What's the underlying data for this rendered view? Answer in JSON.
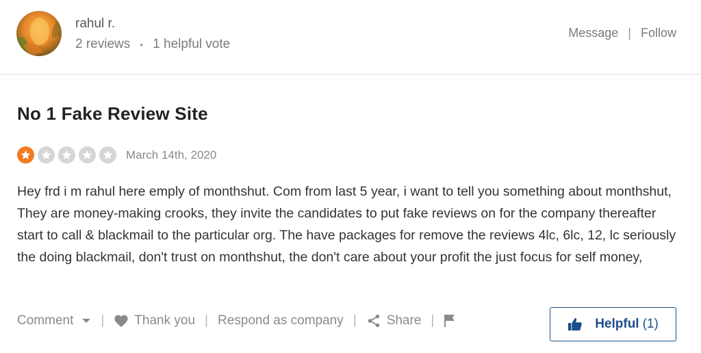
{
  "user": {
    "name": "rahul r.",
    "reviews": "2 reviews",
    "separator": "•",
    "helpful_votes": "1 helpful vote"
  },
  "header_actions": {
    "message": "Message",
    "separator": "|",
    "follow": "Follow"
  },
  "review": {
    "title": "No 1 Fake Review Site",
    "rating": 1,
    "rating_max": 5,
    "date": "March 14th, 2020",
    "text": "Hey frd i m rahul here emply of monthshut. Com from last 5 year, i want to tell you something about monthshut, They are money-making crooks, they invite the candidates to put fake reviews on for the company thereafter start to call & blackmail to the particular org. The have packages for remove the reviews 4lc, 6lc, 12, lc seriously the doing blackmail, don't trust on monthshut, the don't care about your profit the just focus for self money,"
  },
  "actions": {
    "comment": "Comment",
    "thank_you": "Thank you",
    "respond": "Respond as company",
    "share": "Share",
    "separator": "|"
  },
  "helpful": {
    "label": "Helpful",
    "count": "(1)"
  },
  "colors": {
    "star_filled": "#f47b20",
    "star_empty": "#d6d6d6",
    "helpful_blue": "#1b4f8a",
    "muted_text": "#8a8a8a"
  },
  "icons": {
    "avatar": "user-avatar-photo",
    "star": "star-icon",
    "comment_dropdown": "chevron-down-icon",
    "thank_you": "heart-icon",
    "share": "share-icon",
    "flag": "flag-icon",
    "helpful": "thumbs-up-icon"
  }
}
